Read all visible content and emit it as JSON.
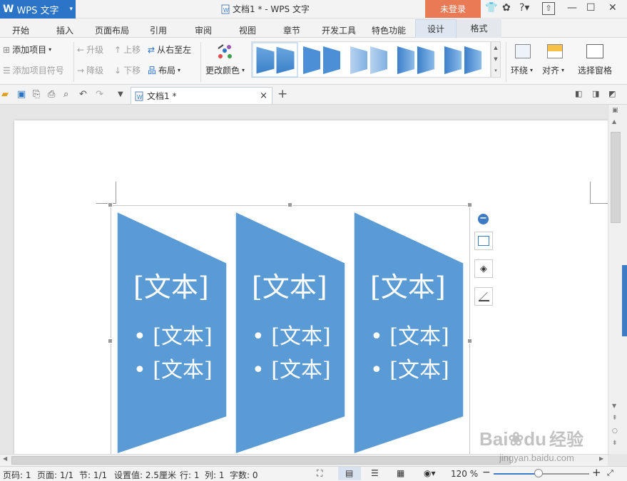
{
  "app": {
    "logo": "W",
    "name": "WPS 文字",
    "dropdown": "▾"
  },
  "window": {
    "title": "文档1 * - WPS 文字",
    "login": "未登录"
  },
  "menu_tabs": [
    "开始",
    "插入",
    "页面布局",
    "引用",
    "审阅",
    "视图",
    "章节",
    "开发工具",
    "特色功能",
    "设计",
    "格式"
  ],
  "ribbon": {
    "add_item": "添加项目",
    "add_bullet": "添加项目符号",
    "promote": "升级",
    "demote": "降级",
    "move_up": "上移",
    "move_down": "下移",
    "right_to_left": "从右至左",
    "layout": "布局",
    "change_colors": "更改颜色",
    "wrap": "环绕",
    "align": "对齐",
    "selection_pane": "选择窗格"
  },
  "doc_tab": {
    "label": "文档1 *",
    "close": "×",
    "new": "+"
  },
  "smartart": {
    "color": "#5b9bd5",
    "shapes": [
      {
        "title": "[文本]",
        "bullets": [
          "[文本]",
          "[文本]"
        ]
      },
      {
        "title": "[文本]",
        "bullets": [
          "[文本]",
          "[文本]"
        ]
      },
      {
        "title": "[文本]",
        "bullets": [
          "[文本]",
          "[文本]"
        ]
      }
    ]
  },
  "status": {
    "page_num": "页码: 1",
    "pages": "页面: 1/1",
    "section": "节: 1/1",
    "setting": "设置值: 2.5厘米",
    "row": "行: 1",
    "col": "列: 1",
    "words": "字数: 0",
    "zoom": "120 %",
    "zoom_level": 0.47
  },
  "watermark": {
    "brand": "Bai",
    "paw": "du",
    "cn": "经验",
    "url": "jingyan.baidu.com"
  }
}
